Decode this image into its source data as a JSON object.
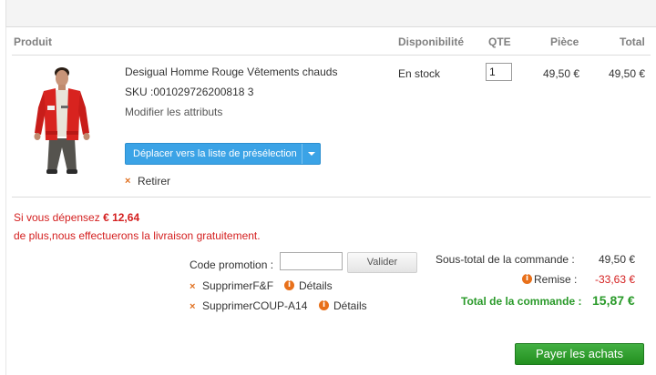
{
  "table": {
    "headers": {
      "product": "Produit",
      "availability": "Disponibilité",
      "qty": "QTE",
      "unit_price": "Pièce",
      "total": "Total"
    }
  },
  "item": {
    "name": "Desigual Homme Rouge Vêtements chauds",
    "sku": "SKU :001029726200818 3",
    "edit_label": "Modifier les attributs",
    "wishlist_label": "Déplacer vers la liste de présélection",
    "remove_label": "Retirer",
    "availability": "En stock",
    "quantity": "1",
    "unit_price": "49,50 €",
    "line_total": "49,50 €"
  },
  "shipping_promo": {
    "line1_prefix": "Si vous dépensez",
    "amount": "€ 12,64",
    "line2": "de plus,nous effectuerons la livraison gratuitement."
  },
  "coupon": {
    "label": "Code promotion :",
    "input_value": "",
    "validate_label": "Valider",
    "applied": [
      {
        "remove_label": "SupprimerF&F",
        "details_label": "Détails"
      },
      {
        "remove_label": "SupprimerCOUP-A14",
        "details_label": "Détails"
      }
    ]
  },
  "summary": {
    "subtotal_label": "Sous-total de la commande :",
    "subtotal_value": "49,50 €",
    "discount_label": "Remise :",
    "discount_value": "-33,63 €",
    "total_label": "Total de la commande :",
    "total_value": "15,87 €"
  },
  "checkout_label": "Payer les achats",
  "colors": {
    "accent_blue": "#3ba3e6",
    "alert_red": "#d42020",
    "total_green": "#2a9a2a",
    "checkout_green": "#23901f",
    "icon_orange": "#e8701a"
  }
}
